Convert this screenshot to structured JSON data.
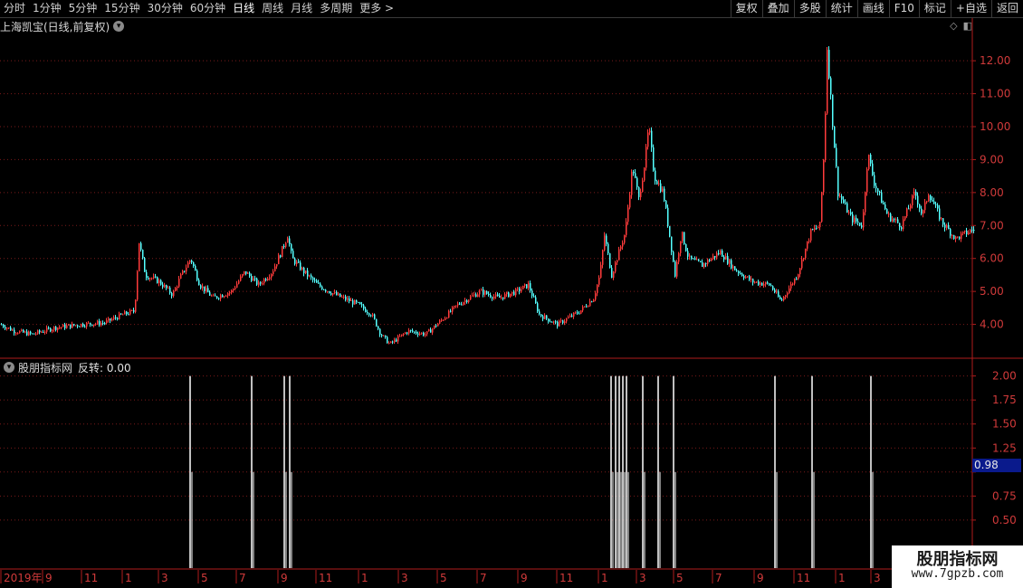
{
  "toolbar": {
    "periods": [
      "分时",
      "1分钟",
      "5分钟",
      "15分钟",
      "30分钟",
      "60分钟",
      "日线",
      "周线",
      "月线",
      "多周期",
      "更多 >"
    ],
    "active_period": "日线",
    "tools": [
      "复权",
      "叠加",
      "多股",
      "统计",
      "画线",
      "F10",
      "标记",
      "+自选",
      "返回"
    ]
  },
  "main_panel": {
    "title": "上海凯宝(日线,前复权)",
    "chevron_icon": "chevron-down-icon",
    "icons": [
      "diamond-icon",
      "window-toggle-icon"
    ]
  },
  "indicator_panel": {
    "name": "股朋指标网",
    "value_label": "反转: 0.00",
    "current_value_tag": "0.98"
  },
  "watermark": {
    "title": "股朋指标网",
    "url": "www.7gpzb.com"
  },
  "colors": {
    "up": "#ff3b3b",
    "down": "#54ffff",
    "axis": "#b01c1c",
    "grid": "#7a1a1a",
    "signal": "#ffffff",
    "tag_bg": "#0a1a8c"
  },
  "chart_data": [
    {
      "type": "candlestick",
      "title": "上海凯宝(日线,前复权)",
      "y_ticks": [
        4.0,
        5.0,
        6.0,
        7.0,
        8.0,
        9.0,
        10.0,
        11.0,
        12.0
      ],
      "ylim": [
        3.0,
        12.8
      ],
      "x_tick_labels": [
        "2019年",
        "9",
        "11",
        "1",
        "3",
        "5",
        "7",
        "9",
        "11",
        "1",
        "3",
        "5",
        "7",
        "9",
        "11",
        "1",
        "3",
        "5",
        "7",
        "9",
        "11",
        "1",
        "3"
      ],
      "grid": true,
      "price_path": [
        [
          0,
          4.0
        ],
        [
          15,
          3.8
        ],
        [
          35,
          3.7
        ],
        [
          60,
          3.9
        ],
        [
          90,
          4.0
        ],
        [
          115,
          4.05
        ],
        [
          135,
          4.3
        ],
        [
          148,
          4.4
        ],
        [
          153,
          6.5
        ],
        [
          160,
          5.5
        ],
        [
          175,
          5.3
        ],
        [
          190,
          4.9
        ],
        [
          198,
          5.4
        ],
        [
          210,
          6.0
        ],
        [
          220,
          5.2
        ],
        [
          235,
          4.8
        ],
        [
          255,
          5.0
        ],
        [
          270,
          5.6
        ],
        [
          285,
          5.2
        ],
        [
          300,
          5.6
        ],
        [
          310,
          6.2
        ],
        [
          317,
          6.7
        ],
        [
          322,
          6.0
        ],
        [
          335,
          5.6
        ],
        [
          350,
          5.2
        ],
        [
          370,
          4.9
        ],
        [
          395,
          4.6
        ],
        [
          410,
          4.3
        ],
        [
          420,
          3.7
        ],
        [
          430,
          3.4
        ],
        [
          450,
          3.8
        ],
        [
          470,
          3.7
        ],
        [
          490,
          4.2
        ],
        [
          505,
          4.6
        ],
        [
          530,
          5.0
        ],
        [
          550,
          4.8
        ],
        [
          570,
          5.0
        ],
        [
          583,
          5.2
        ],
        [
          595,
          4.3
        ],
        [
          615,
          4.0
        ],
        [
          640,
          4.4
        ],
        [
          655,
          4.8
        ],
        [
          662,
          5.5
        ],
        [
          667,
          6.7
        ],
        [
          675,
          5.5
        ],
        [
          690,
          6.8
        ],
        [
          698,
          8.8
        ],
        [
          705,
          7.8
        ],
        [
          712,
          9.0
        ],
        [
          716,
          10.0
        ],
        [
          722,
          8.5
        ],
        [
          732,
          8.0
        ],
        [
          740,
          6.5
        ],
        [
          745,
          5.5
        ],
        [
          752,
          6.8
        ],
        [
          760,
          6.0
        ],
        [
          775,
          5.8
        ],
        [
          795,
          6.2
        ],
        [
          810,
          5.7
        ],
        [
          830,
          5.3
        ],
        [
          850,
          5.2
        ],
        [
          862,
          4.7
        ],
        [
          880,
          5.5
        ],
        [
          895,
          6.8
        ],
        [
          905,
          7.0
        ],
        [
          910,
          9.5
        ],
        [
          913,
          12.4
        ],
        [
          918,
          10.5
        ],
        [
          925,
          8.0
        ],
        [
          940,
          7.2
        ],
        [
          952,
          7.0
        ],
        [
          958,
          9.2
        ],
        [
          965,
          8.3
        ],
        [
          980,
          7.3
        ],
        [
          995,
          7.0
        ],
        [
          1010,
          8.0
        ],
        [
          1018,
          7.3
        ],
        [
          1025,
          8.0
        ],
        [
          1040,
          7.1
        ],
        [
          1055,
          6.6
        ],
        [
          1075,
          6.9
        ]
      ]
    },
    {
      "type": "bar",
      "series_label": "反转",
      "value": 0.0,
      "y_ticks": [
        0.5,
        0.75,
        1.0,
        1.25,
        1.5,
        1.75,
        2.0
      ],
      "ylim": [
        0.0,
        2.1
      ],
      "signals": [
        [
          210,
          2
        ],
        [
          278,
          2
        ],
        [
          314,
          2
        ],
        [
          320,
          2
        ],
        [
          675,
          2
        ],
        [
          680,
          2
        ],
        [
          684,
          2
        ],
        [
          688,
          2
        ],
        [
          692,
          2
        ],
        [
          710,
          2
        ],
        [
          727,
          2
        ],
        [
          744,
          2
        ],
        [
          856,
          2
        ],
        [
          897,
          2
        ],
        [
          962,
          2
        ]
      ]
    }
  ]
}
